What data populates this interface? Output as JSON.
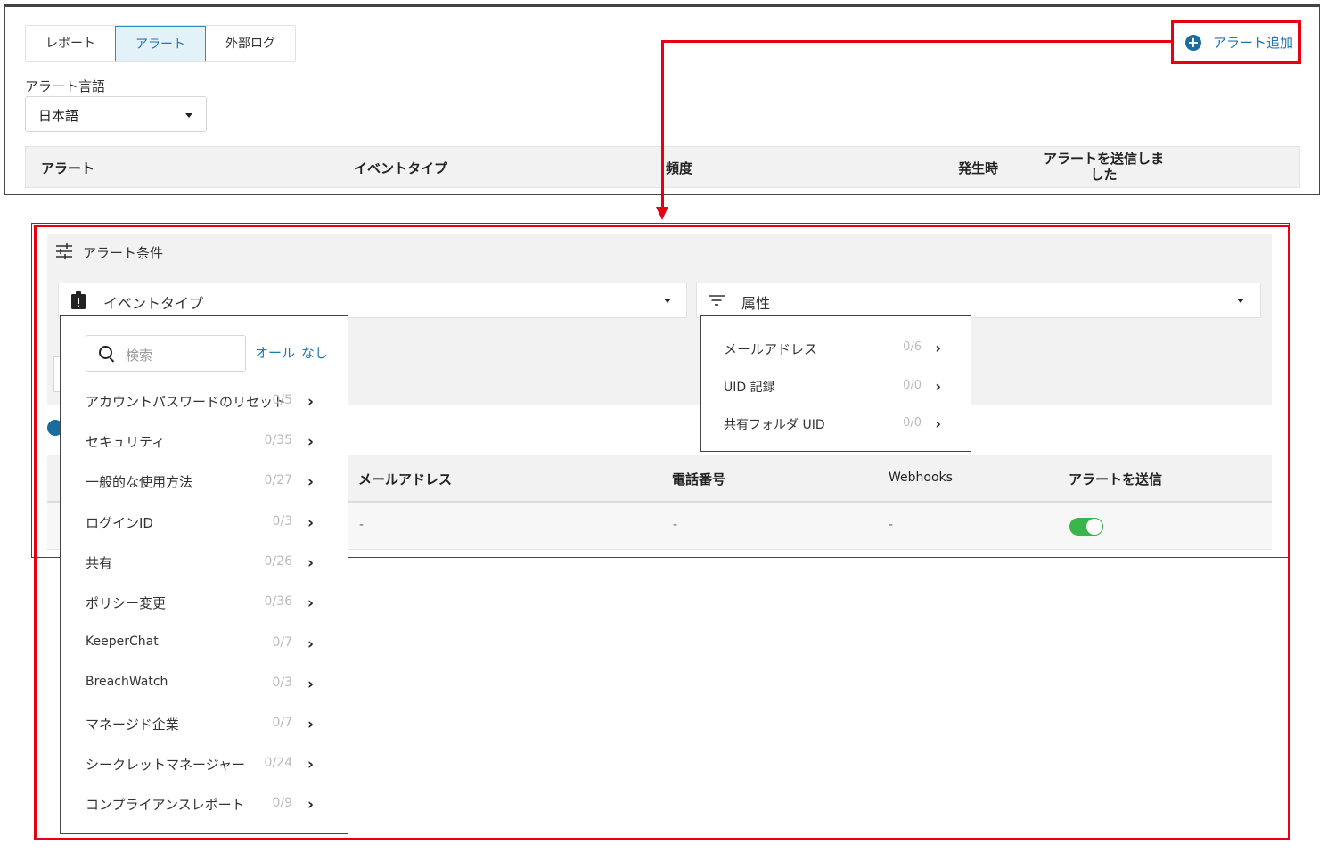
{
  "top": {
    "tabs": [
      {
        "label": "レポート",
        "active": false
      },
      {
        "label": "アラート",
        "active": true
      },
      {
        "label": "外部ログ",
        "active": false
      }
    ],
    "add_alert_label": "アラート追加",
    "language_label": "アラート言語",
    "language_value": "日本語",
    "table_headers": {
      "alert": "アラート",
      "event_type": "イベントタイプ",
      "frequency": "頻度",
      "occurred": "発生時",
      "sent_line1": "アラートを送信しま",
      "sent_line2": "した"
    }
  },
  "conditions": {
    "title": "アラート条件",
    "event_type_label": "イベントタイプ",
    "attribute_label": "属性"
  },
  "event_dropdown": {
    "search_placeholder": "検索",
    "all_label": "オール",
    "none_label": "なし",
    "items": [
      {
        "label": "アカウントパスワードのリセット",
        "count": "0/5"
      },
      {
        "label": "セキュリティ",
        "count": "0/35"
      },
      {
        "label": "一般的な使用方法",
        "count": "0/27"
      },
      {
        "label": "ログインID",
        "count": "0/3"
      },
      {
        "label": "共有",
        "count": "0/26"
      },
      {
        "label": "ポリシー変更",
        "count": "0/36"
      },
      {
        "label": "KeeperChat",
        "count": "0/7"
      },
      {
        "label": "BreachWatch",
        "count": "0/3"
      },
      {
        "label": "マネージド企業",
        "count": "0/7"
      },
      {
        "label": "シークレットマネージャー",
        "count": "0/24"
      },
      {
        "label": "コンプライアンスレポート",
        "count": "0/9"
      }
    ]
  },
  "attribute_dropdown": {
    "items": [
      {
        "label": "メールアドレス",
        "count": "0/6"
      },
      {
        "label": "UID 記録",
        "count": "0/0"
      },
      {
        "label": "共有フォルダ UID",
        "count": "0/0"
      }
    ]
  },
  "recipients": {
    "headers": {
      "email": "メールアドレス",
      "phone": "電話番号",
      "webhooks": "Webhooks",
      "send_alert": "アラートを送信"
    },
    "row": {
      "email": "-",
      "phone": "-",
      "webhooks": "-",
      "send_alert_enabled": true
    }
  },
  "colors": {
    "highlight_red": "#e60012",
    "accent_blue": "#1b78b0",
    "toggle_green": "#39b54a"
  }
}
